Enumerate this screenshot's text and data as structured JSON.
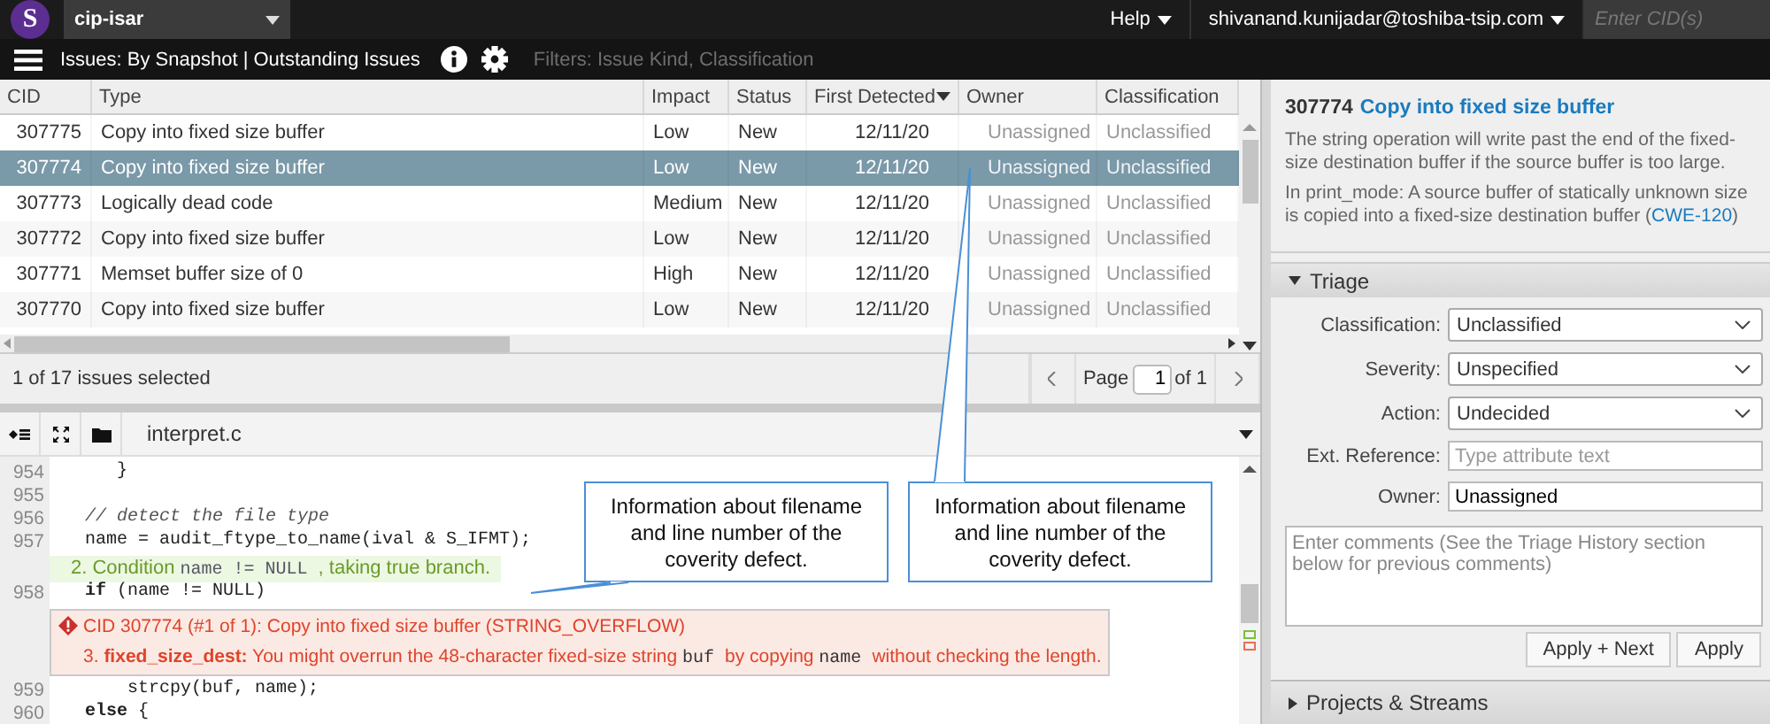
{
  "top_bar": {
    "logo": "S",
    "project": "cip-isar",
    "help": "Help",
    "user": "shivanand.kunijadar@toshiba-tsip.com",
    "cid_field": {
      "placeholder": "Enter CID(s)"
    }
  },
  "view_bar": {
    "title": "Issues: By Snapshot | Outstanding Issues",
    "filters": "Filters: Issue Kind, Classification"
  },
  "issues_table": {
    "columns": [
      {
        "label": "CID",
        "sorted": false
      },
      {
        "label": "Type",
        "sorted": false
      },
      {
        "label": "Impact",
        "sorted": false
      },
      {
        "label": "Status",
        "sorted": false
      },
      {
        "label": "First Detected",
        "sorted": true
      },
      {
        "label": "Owner",
        "sorted": false
      },
      {
        "label": "Classification",
        "sorted": false
      }
    ],
    "rows": [
      {
        "cid": "307775",
        "type": "Copy into fixed size buffer",
        "impact": "Low",
        "status": "New",
        "first_detected": "12/11/20",
        "owner": "Unassigned",
        "classification": "Unclassified",
        "selected": false
      },
      {
        "cid": "307774",
        "type": "Copy into fixed size buffer",
        "impact": "Low",
        "status": "New",
        "first_detected": "12/11/20",
        "owner": "Unassigned",
        "classification": "Unclassified",
        "selected": true
      },
      {
        "cid": "307773",
        "type": "Logically dead code",
        "impact": "Medium",
        "status": "New",
        "first_detected": "12/11/20",
        "owner": "Unassigned",
        "classification": "Unclassified",
        "selected": false
      },
      {
        "cid": "307772",
        "type": "Copy into fixed size buffer",
        "impact": "Low",
        "status": "New",
        "first_detected": "12/11/20",
        "owner": "Unassigned",
        "classification": "Unclassified",
        "selected": false
      },
      {
        "cid": "307771",
        "type": "Memset buffer size of 0",
        "impact": "High",
        "status": "New",
        "first_detected": "12/11/20",
        "owner": "Unassigned",
        "classification": "Unclassified",
        "selected": false
      },
      {
        "cid": "307770",
        "type": "Copy into fixed size buffer",
        "impact": "Low",
        "status": "New",
        "first_detected": "12/11/20",
        "owner": "Unassigned",
        "classification": "Unclassified",
        "selected": false
      }
    ]
  },
  "table_footer": {
    "selection": "1 of 17 issues selected",
    "page_label": "Page",
    "page": "1",
    "page_count": "of 1"
  },
  "source": {
    "file": "interpret.c",
    "lines": [
      {
        "kind": "code",
        "number": "954",
        "text": "   }"
      },
      {
        "kind": "code",
        "number": "955"
      },
      {
        "kind": "comment",
        "number": "956",
        "text": "// detect the file type"
      },
      {
        "kind": "code",
        "number": "957",
        "text": "name = audit_ftype_to_name(ival & S_IFMT);"
      },
      {
        "kind": "event",
        "segments": [
          {
            "kind": "text",
            "text": "2. Condition "
          },
          {
            "kind": "code",
            "text": "name != NULL"
          },
          {
            "kind": "text",
            "text": ", taking true branch."
          }
        ]
      },
      {
        "kind": "code",
        "number": "958",
        "text": "**if** (name != NULL)"
      },
      {
        "kind": "defect",
        "title": "CID 307774 (#1 of 1): Copy into fixed size buffer (STRING_OVERFLOW)",
        "segments": [
          {
            "kind": "text",
            "text": "3. **fixed_size_dest:** You might overrun the 48-character fixed-size string "
          },
          {
            "kind": "code",
            "text": "buf"
          },
          {
            "kind": "text",
            "text": " by copying "
          },
          {
            "kind": "code",
            "text": "name"
          },
          {
            "kind": "text",
            "text": " without checking the length."
          }
        ]
      },
      {
        "kind": "code",
        "number": "959",
        "text": "    strcpy(buf, name);"
      },
      {
        "kind": "code",
        "number": "960",
        "text": "**else** {"
      }
    ]
  },
  "callouts": [
    {
      "text": "Information about filename and line number of the coverity defect."
    },
    {
      "text": "Information about filename and line number of the coverity defect."
    }
  ],
  "issue_detail": {
    "cid": "307774",
    "title": "Copy into fixed size buffer",
    "description": "The string operation will write past the end of the fixed-size destination buffer if the source buffer is too large.",
    "print_mode": {
      "text": "In print_mode: A source buffer of statically unknown size is copied into a fixed-size destination buffer (",
      "link": "CWE-120",
      "after": ")"
    }
  },
  "triage": {
    "title": "Triage",
    "expanded": true,
    "fields": [
      {
        "kind": "select",
        "label": "Classification:",
        "value": "Unclassified"
      },
      {
        "kind": "select",
        "label": "Severity:",
        "value": "Unspecified"
      },
      {
        "kind": "select",
        "label": "Action:",
        "value": "Undecided"
      },
      {
        "kind": "text",
        "label": "Ext. Reference:",
        "placeholder": "Type attribute text"
      },
      {
        "kind": "text",
        "label": "Owner:",
        "value": "Unassigned"
      }
    ],
    "comments": {
      "placeholder": "Enter comments (See the Triage History section below for previous comments)"
    },
    "buttons": [
      "Apply + Next",
      "Apply"
    ]
  },
  "projects_streams": {
    "title": "Projects & Streams",
    "expanded": false
  }
}
